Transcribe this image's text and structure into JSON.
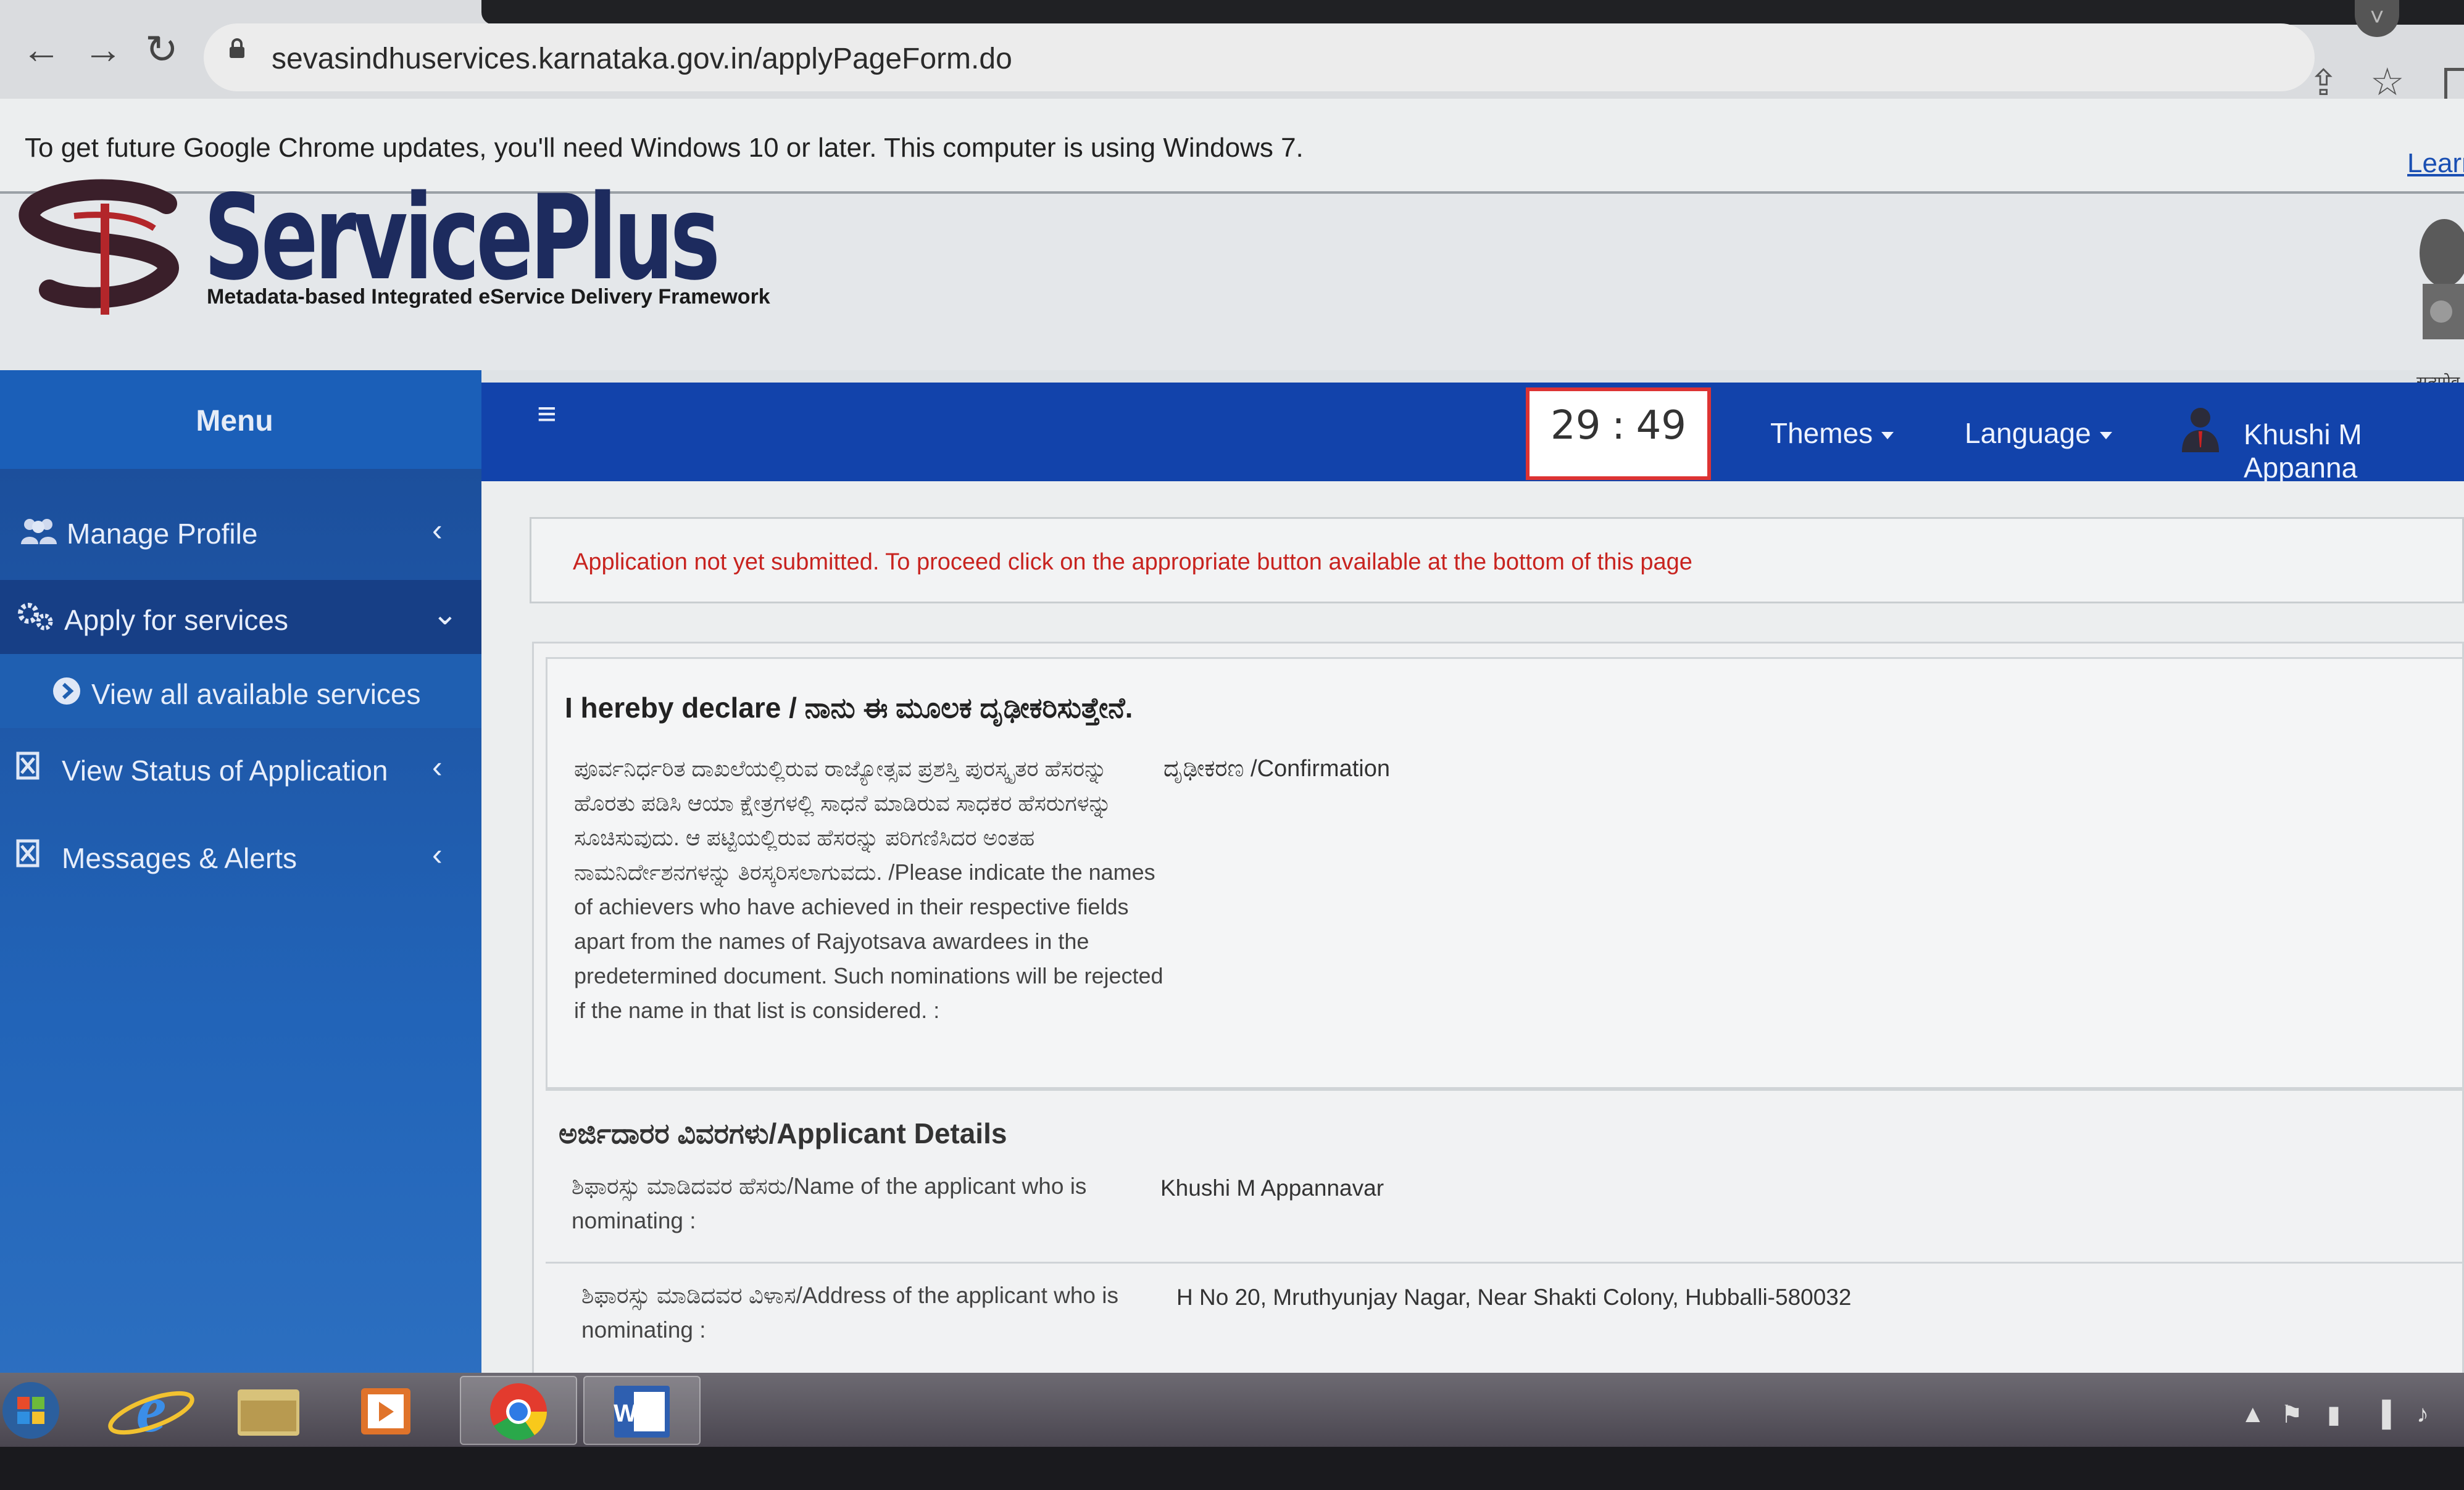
{
  "browser": {
    "url": "sevasindhuservices.karnataka.gov.in/applyPageForm.do",
    "back_icon": "←",
    "forward_icon": "→",
    "reload_icon": "↻",
    "share_icon": "⇪",
    "star_icon": "☆",
    "scroll_icon": "˅"
  },
  "infobar": {
    "message": "To get future Google Chrome updates, you'll need Windows 10 or later. This computer is using Windows 7.",
    "link": "Learn"
  },
  "site": {
    "brand": "ServicePlus",
    "tagline": "Metadata-based Integrated eService Delivery Framework",
    "emblem_caption": "सत्यमेव"
  },
  "nav": {
    "menu_label": "Menu",
    "hamburger": "≡",
    "timer_minutes": "29",
    "timer_sep": ":",
    "timer_seconds": "49",
    "themes": "Themes",
    "language": "Language",
    "user_name": "Khushi M Appanna"
  },
  "sidebar": {
    "items": [
      {
        "label": "Manage Profile",
        "icon": "users-icon",
        "chevron": "‹"
      },
      {
        "label": "Apply for services",
        "icon": "gears-icon",
        "chevron": "⌄"
      },
      {
        "label": "View all available services",
        "icon": "arrow-circle-icon"
      },
      {
        "label": "View Status of Application",
        "icon": "box-x-icon",
        "chevron": "‹"
      },
      {
        "label": "Messages & Alerts",
        "icon": "box-x-icon",
        "chevron": "‹"
      }
    ]
  },
  "main": {
    "alert": "Application not yet submitted. To proceed click on the appropriate button available at the bottom of this page",
    "declare_title": "I hereby declare / ನಾನು ಈ ಮೂಲಕ ದೃಢೀಕರಿಸುತ್ತೇನೆ.",
    "declare_body_kn": "ಪೂರ್ವನಿರ್ಧರಿತ ದಾಖಲೆಯಲ್ಲಿರುವ ರಾಜ್ಯೋತ್ಸವ ಪ್ರಶಸ್ತಿ ಪುರಸ್ಕೃತರ ಹೆಸರನ್ನು ಹೊರತು ಪಡಿಸಿ ಆಯಾ ಕ್ಷೇತ್ರಗಳಲ್ಲಿ ಸಾಧನೆ ಮಾಡಿರುವ ಸಾಧಕರ ಹೆಸರುಗಳನ್ನು ಸೂಚಿಸುವುದು. ಆ ಪಟ್ಟಿಯಲ್ಲಿರುವ ಹೆಸರನ್ನು ಪರಿಗಣಿಸಿದರ ಅಂತಹ ನಾಮನಿರ್ದೇಶನಗಳನ್ನು ತಿರಸ್ಕರಿಸಲಾಗುವದು.",
    "declare_body_en": "/Please indicate the names of achievers who have achieved in their respective fields apart from the names of Rajyotsava awardees in the predetermined document. Such nominations will be rejected if the name in that list is considered. :",
    "confirmation": "ದೃಢೀಕರಣ /Confirmation",
    "applicant_title": "ಅರ್ಜಿದಾರರ ವಿವರಗಳು/Applicant Details",
    "name_label": "ಶಿಫಾರಸ್ಸು ಮಾಡಿದವರ ಹೆಸರು/Name of the applicant who is nominating :",
    "name_value": "Khushi M Appannavar",
    "address_label": "ಶಿಫಾರಸ್ಸು ಮಾಡಿದವರ ವಿಳಾಸ/Address of the applicant who is nominating :",
    "address_value": "H No 20, Mruthyunjay Nagar, Near Shakti Colony, Hubballi-580032"
  },
  "taskbar": {
    "items": [
      "start-orb",
      "internet-explorer",
      "file-explorer",
      "media-player",
      "chrome",
      "word"
    ],
    "tray_up": "▲",
    "tray_flag": "⚑",
    "tray_signal": "▐",
    "tray_volume": "♪"
  },
  "colors": {
    "nav_blue": "#1243ab",
    "sidebar_blue": "#1c4f9c",
    "alert_red": "#c8231f",
    "timer_border": "#dd3333"
  }
}
